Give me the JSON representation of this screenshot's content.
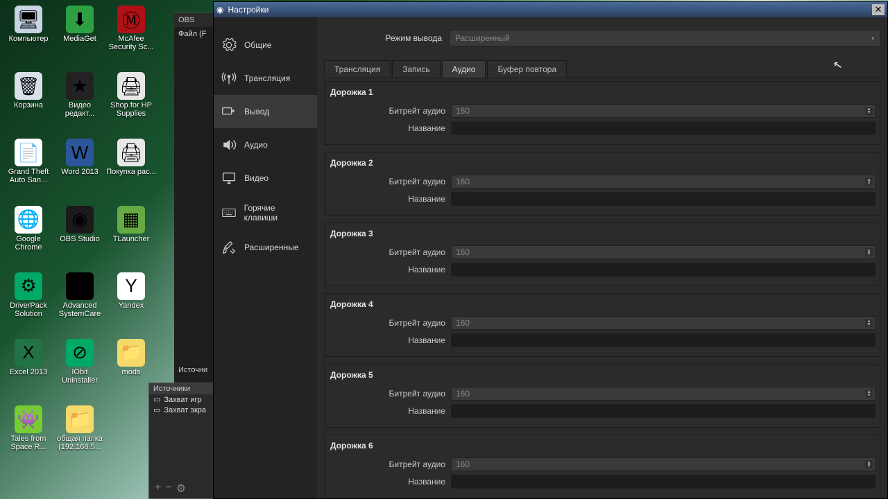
{
  "desktop": {
    "icons": [
      {
        "label": "Компьютер",
        "bg": "#c8d4e4",
        "glyph": "🖥"
      },
      {
        "label": "MediaGet",
        "bg": "#2ea043",
        "glyph": "⬇"
      },
      {
        "label": "McAfee Security Sc...",
        "bg": "#b01116",
        "glyph": "Ⓜ"
      },
      {
        "label": "Корзина",
        "bg": "#d8e0e8",
        "glyph": "🗑"
      },
      {
        "label": "Видео редакт...",
        "bg": "#222",
        "glyph": "★"
      },
      {
        "label": "Shop for HP Supplies",
        "bg": "#e8e8e8",
        "glyph": "🖨"
      },
      {
        "label": "Grand Theft Auto San...",
        "bg": "#fff",
        "glyph": "📄"
      },
      {
        "label": "Word 2013",
        "bg": "#2b579a",
        "glyph": "W"
      },
      {
        "label": "Покупка рас...",
        "bg": "#e8e8e8",
        "glyph": "🖨"
      },
      {
        "label": "Google Chrome",
        "bg": "#fff",
        "glyph": "🌐"
      },
      {
        "label": "OBS Studio",
        "bg": "#1a1a1a",
        "glyph": "◉"
      },
      {
        "label": "TLauncher",
        "bg": "#6a4",
        "glyph": "▦"
      },
      {
        "label": "DriverPack Solution",
        "bg": "#0a6",
        "glyph": "⚙"
      },
      {
        "label": "Advanced SystemCare",
        "bg": "#000",
        "glyph": "◯"
      },
      {
        "label": "Yandex",
        "bg": "#fff",
        "glyph": "Y"
      },
      {
        "label": "Excel 2013",
        "bg": "#217346",
        "glyph": "X"
      },
      {
        "label": "IObit Uninstaller",
        "bg": "#0a6",
        "glyph": "⊘"
      },
      {
        "label": "mods",
        "bg": "#f6d96b",
        "glyph": "📁"
      },
      {
        "label": "Tales from Space R...",
        "bg": "#7c3",
        "glyph": "👾"
      },
      {
        "label": "общая папка (192.168.5...",
        "bg": "#f6d96b",
        "glyph": "📁"
      }
    ]
  },
  "obs_bg": {
    "title": "OBS",
    "menu": "Файл (F",
    "sources": "Источни"
  },
  "sources_panel": {
    "title": "Источники",
    "items": [
      "Захват игр",
      "Захват экра"
    ],
    "plus": "+",
    "minus": "−",
    "gear": "⚙"
  },
  "settings": {
    "title": "Настройки",
    "sidebar": [
      {
        "label": "Общие",
        "icon": "gear"
      },
      {
        "label": "Трансляция",
        "icon": "antenna"
      },
      {
        "label": "Вывод",
        "icon": "output",
        "selected": true
      },
      {
        "label": "Аудио",
        "icon": "speaker"
      },
      {
        "label": "Видео",
        "icon": "monitor"
      },
      {
        "label": "Горячие клавиши",
        "icon": "keyboard"
      },
      {
        "label": "Расширенные",
        "icon": "tools"
      }
    ],
    "mode_label": "Режим вывода",
    "mode_value": "Расширенный",
    "tabs": [
      "Трансляция",
      "Запись",
      "Аудио",
      "Буфер повтора"
    ],
    "active_tab": 2,
    "bitrate_label": "Битрейт аудио",
    "name_label": "Название",
    "tracks": [
      {
        "title": "Дорожка 1",
        "bitrate": "160",
        "name": ""
      },
      {
        "title": "Дорожка 2",
        "bitrate": "160",
        "name": ""
      },
      {
        "title": "Дорожка 3",
        "bitrate": "160",
        "name": ""
      },
      {
        "title": "Дорожка 4",
        "bitrate": "160",
        "name": ""
      },
      {
        "title": "Дорожка 5",
        "bitrate": "160",
        "name": ""
      },
      {
        "title": "Дорожка 6",
        "bitrate": "160",
        "name": ""
      }
    ]
  }
}
